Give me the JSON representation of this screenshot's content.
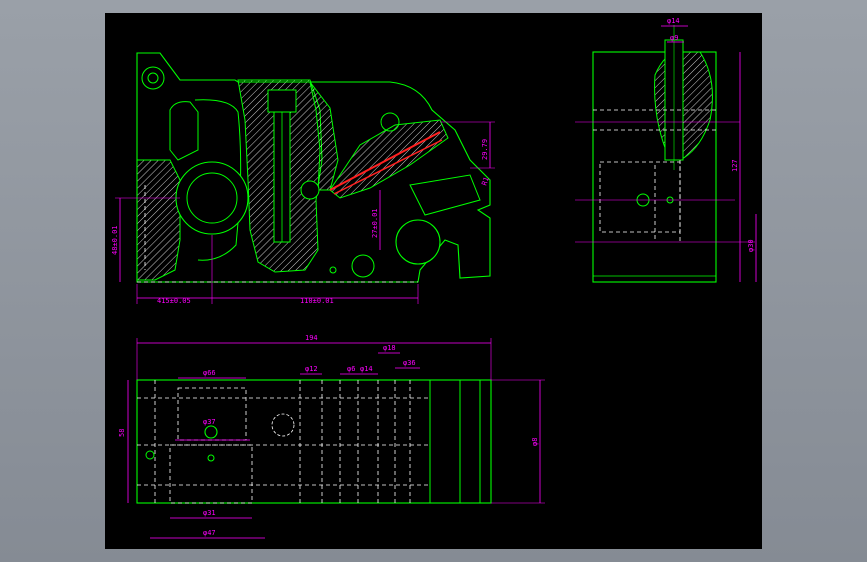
{
  "colors": {
    "background": "#000000",
    "outline": "#00ff00",
    "dimension": "#ff00ff",
    "hidden": "#ffffff",
    "hatch": "#ffffff",
    "highlight": "#ff2020"
  },
  "front_view": {
    "dims": {
      "left_height": "48±0.01",
      "bottom_left": "415±0.05",
      "bottom_right": "110±0.01",
      "center_v": "27±0.01",
      "right_v": "29.79",
      "angle": "R1"
    }
  },
  "side_view": {
    "dims": {
      "top_outer": "φ14",
      "top_inner": "φ9",
      "right_height": "127",
      "right_lower": "φ30"
    }
  },
  "plan_view": {
    "dims": {
      "overall": "194",
      "left_height": "58",
      "right_height": "φ8",
      "top_a": "φ66",
      "top_b": "φ12",
      "top_c": "φ6",
      "top_d": "φ14",
      "top_e": "φ18",
      "top_f": "φ36",
      "inner_circle": "φ37",
      "bottom_a": "φ31",
      "bottom_b": "φ47"
    }
  }
}
